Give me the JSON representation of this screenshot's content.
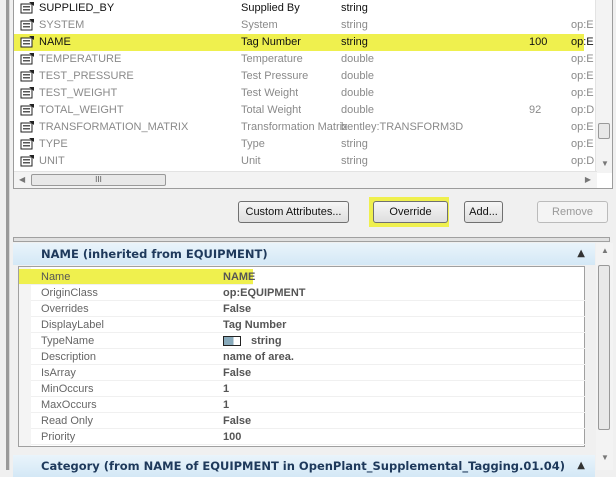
{
  "table": {
    "rows": [
      {
        "name": "SUPPLIED_BY",
        "label": "Supplied By",
        "type": "string",
        "size": "",
        "class": "",
        "state": "active"
      },
      {
        "name": "SYSTEM",
        "label": "System",
        "type": "string",
        "size": "",
        "class": "op:E",
        "state": "inherited"
      },
      {
        "name": "NAME",
        "label": "Tag Number",
        "type": "string",
        "size": "100",
        "class": "op:E",
        "state": "selected"
      },
      {
        "name": "TEMPERATURE",
        "label": "Temperature",
        "type": "double",
        "size": "",
        "class": "op:E",
        "state": "inherited"
      },
      {
        "name": "TEST_PRESSURE",
        "label": "Test Pressure",
        "type": "double",
        "size": "",
        "class": "op:E",
        "state": "inherited"
      },
      {
        "name": "TEST_WEIGHT",
        "label": "Test Weight",
        "type": "double",
        "size": "",
        "class": "op:E",
        "state": "inherited"
      },
      {
        "name": "TOTAL_WEIGHT",
        "label": "Total Weight",
        "type": "double",
        "size": "92",
        "class": "op:D",
        "state": "inherited"
      },
      {
        "name": "TRANSFORMATION_MATRIX",
        "label": "Transformation Matrix",
        "type": "bentley:TRANSFORM3D",
        "size": "",
        "class": "op:E",
        "state": "inherited"
      },
      {
        "name": "TYPE",
        "label": "Type",
        "type": "string",
        "size": "",
        "class": "op:E",
        "state": "inherited"
      },
      {
        "name": "UNIT",
        "label": "Unit",
        "type": "string",
        "size": "",
        "class": "op:D",
        "state": "inherited"
      }
    ],
    "hscroll_grip": "III"
  },
  "buttons": {
    "custom": "Custom Attributes...",
    "override": "Override",
    "add": "Add...",
    "remove": "Remove"
  },
  "section": {
    "title": "NAME (inherited from EQUIPMENT)",
    "properties": [
      {
        "label": "Name",
        "value": "NAME"
      },
      {
        "label": "OriginClass",
        "value": "op:EQUIPMENT"
      },
      {
        "label": "Overrides",
        "value": "False"
      },
      {
        "label": "DisplayLabel",
        "value": "Tag Number"
      },
      {
        "label": "TypeName",
        "value": "string"
      },
      {
        "label": "Description",
        "value": "name of area."
      },
      {
        "label": "IsArray",
        "value": "False"
      },
      {
        "label": "MinOccurs",
        "value": "1"
      },
      {
        "label": "MaxOccurs",
        "value": "1"
      },
      {
        "label": "Read Only",
        "value": "False"
      },
      {
        "label": "Priority",
        "value": "100"
      }
    ]
  },
  "section2": {
    "title": "Category (from NAME of EQUIPMENT in OpenPlant_Supplemental_Tagging.01.04)"
  },
  "colors": {
    "highlight": "#eff04e",
    "section_header": "#d4e8f6"
  }
}
